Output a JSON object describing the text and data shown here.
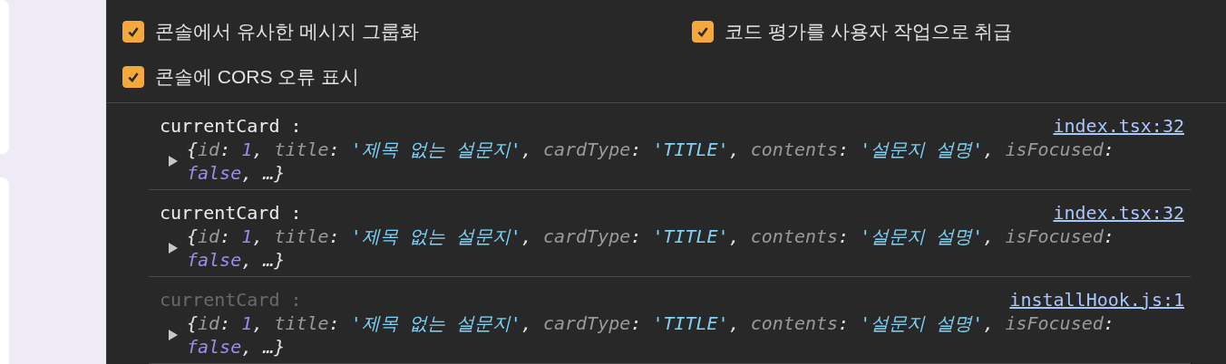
{
  "settings": [
    {
      "label": "콘솔에서 유사한 메시지 그룹화",
      "checked": true
    },
    {
      "label": "코드 평가를 사용자 작업으로 취급",
      "checked": true
    },
    {
      "label": "콘솔에 CORS 오류 표시",
      "checked": true
    }
  ],
  "console_messages": [
    {
      "label": "currentCard :",
      "source": "index.tsx:32",
      "dimmed": false,
      "expanded": false,
      "preview": [
        [
          {
            "kind": "punct",
            "text": "{"
          },
          {
            "kind": "key",
            "text": "id"
          },
          {
            "kind": "punct",
            "text": ": "
          },
          {
            "kind": "number",
            "text": "1"
          },
          {
            "kind": "punct",
            "text": ", "
          },
          {
            "kind": "key",
            "text": "title"
          },
          {
            "kind": "punct",
            "text": ": "
          },
          {
            "kind": "string",
            "text": "'제목 없는 설문지'"
          },
          {
            "kind": "punct",
            "text": ", "
          },
          {
            "kind": "key",
            "text": "cardType"
          },
          {
            "kind": "punct",
            "text": ": "
          },
          {
            "kind": "string",
            "text": "'TITLE'"
          },
          {
            "kind": "punct",
            "text": ", "
          },
          {
            "kind": "key",
            "text": "contents"
          },
          {
            "kind": "punct",
            "text": ": "
          },
          {
            "kind": "string",
            "text": "'설문지 설명'"
          },
          {
            "kind": "punct",
            "text": ", "
          },
          {
            "kind": "key",
            "text": "isFocused"
          },
          {
            "kind": "punct",
            "text": ":"
          }
        ],
        [
          {
            "kind": "bool",
            "text": "false"
          },
          {
            "kind": "punct",
            "text": ", …}"
          }
        ]
      ]
    },
    {
      "label": "currentCard :",
      "source": "index.tsx:32",
      "dimmed": false,
      "expanded": false,
      "preview": [
        [
          {
            "kind": "punct",
            "text": "{"
          },
          {
            "kind": "key",
            "text": "id"
          },
          {
            "kind": "punct",
            "text": ": "
          },
          {
            "kind": "number",
            "text": "1"
          },
          {
            "kind": "punct",
            "text": ", "
          },
          {
            "kind": "key",
            "text": "title"
          },
          {
            "kind": "punct",
            "text": ": "
          },
          {
            "kind": "string",
            "text": "'제목 없는 설문지'"
          },
          {
            "kind": "punct",
            "text": ", "
          },
          {
            "kind": "key",
            "text": "cardType"
          },
          {
            "kind": "punct",
            "text": ": "
          },
          {
            "kind": "string",
            "text": "'TITLE'"
          },
          {
            "kind": "punct",
            "text": ", "
          },
          {
            "kind": "key",
            "text": "contents"
          },
          {
            "kind": "punct",
            "text": ": "
          },
          {
            "kind": "string",
            "text": "'설문지 설명'"
          },
          {
            "kind": "punct",
            "text": ", "
          },
          {
            "kind": "key",
            "text": "isFocused"
          },
          {
            "kind": "punct",
            "text": ":"
          }
        ],
        [
          {
            "kind": "bool",
            "text": "false"
          },
          {
            "kind": "punct",
            "text": ", …}"
          }
        ]
      ]
    },
    {
      "label": "currentCard :",
      "source": "installHook.js:1",
      "dimmed": true,
      "expanded": false,
      "preview": [
        [
          {
            "kind": "punct",
            "text": "{"
          },
          {
            "kind": "key",
            "text": "id"
          },
          {
            "kind": "punct",
            "text": ": "
          },
          {
            "kind": "number",
            "text": "1"
          },
          {
            "kind": "punct",
            "text": ", "
          },
          {
            "kind": "key",
            "text": "title"
          },
          {
            "kind": "punct",
            "text": ": "
          },
          {
            "kind": "string",
            "text": "'제목 없는 설문지'"
          },
          {
            "kind": "punct",
            "text": ", "
          },
          {
            "kind": "key",
            "text": "cardType"
          },
          {
            "kind": "punct",
            "text": ": "
          },
          {
            "kind": "string",
            "text": "'TITLE'"
          },
          {
            "kind": "punct",
            "text": ", "
          },
          {
            "kind": "key",
            "text": "contents"
          },
          {
            "kind": "punct",
            "text": ": "
          },
          {
            "kind": "string",
            "text": "'설문지 설명'"
          },
          {
            "kind": "punct",
            "text": ", "
          },
          {
            "kind": "key",
            "text": "isFocused"
          },
          {
            "kind": "punct",
            "text": ":"
          }
        ],
        [
          {
            "kind": "bool",
            "text": "false"
          },
          {
            "kind": "punct",
            "text": ", …}"
          }
        ]
      ]
    }
  ]
}
